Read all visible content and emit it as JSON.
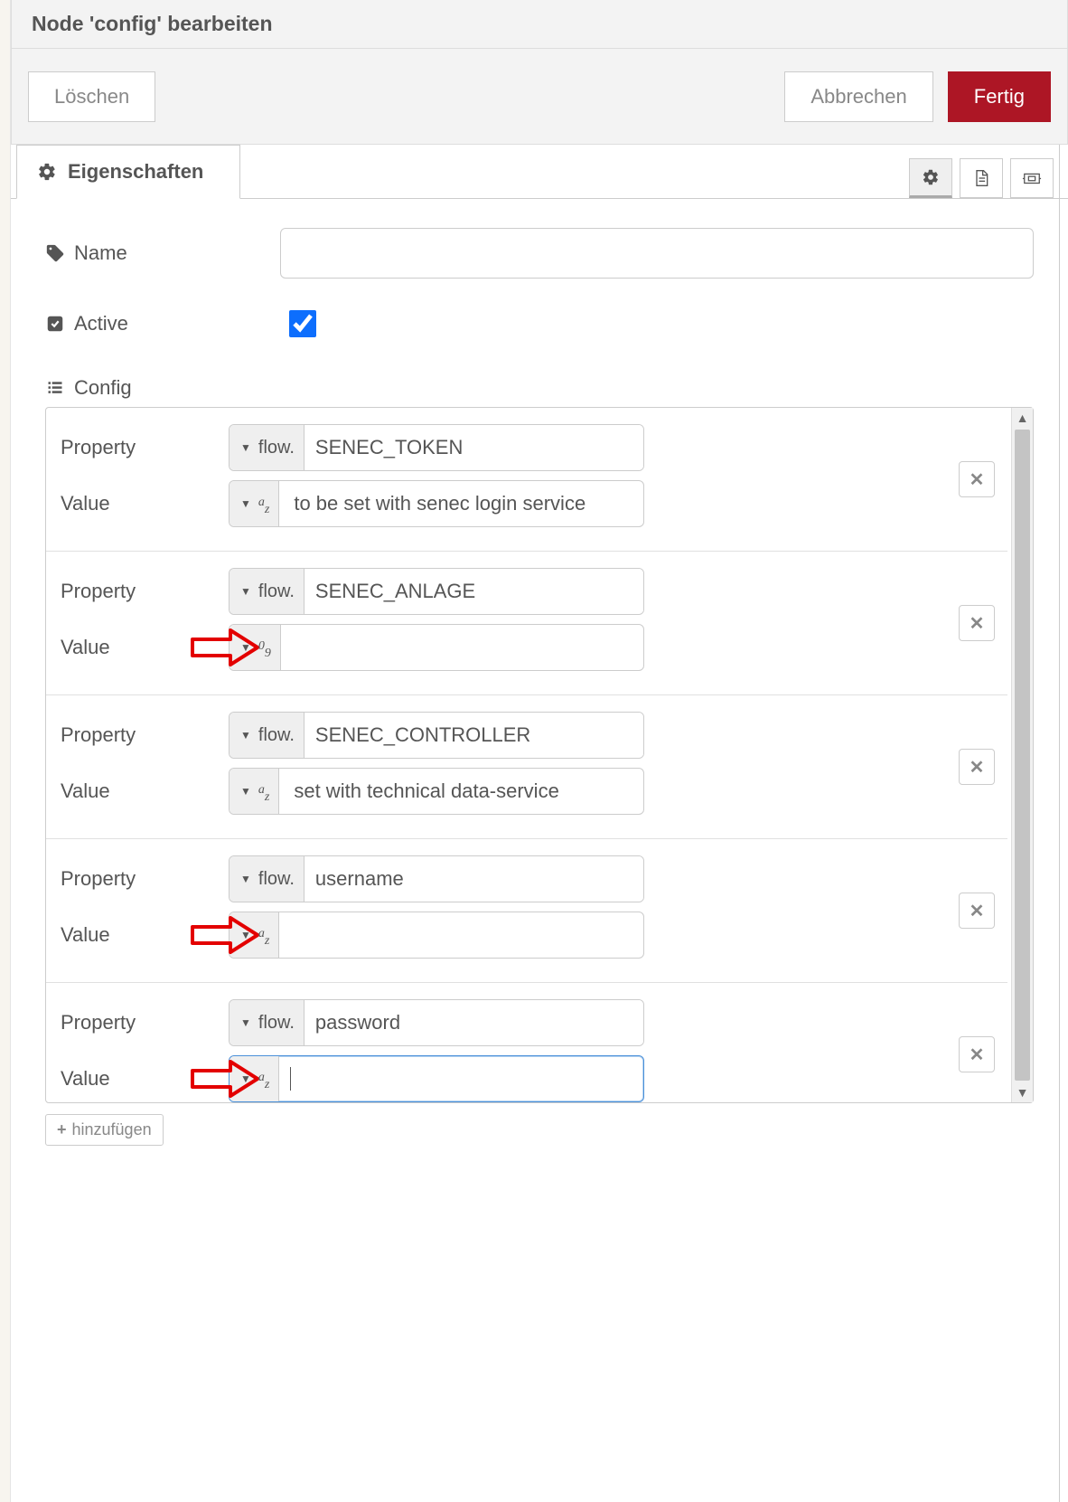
{
  "title": "Node 'config' bearbeiten",
  "buttons": {
    "delete": "Löschen",
    "cancel": "Abbrechen",
    "done": "Fertig"
  },
  "tab": {
    "properties": "Eigenschaften"
  },
  "labels": {
    "name": "Name",
    "active": "Active",
    "config": "Config",
    "property": "Property",
    "value": "Value",
    "flow_prefix": "flow.",
    "add": "hinzufügen"
  },
  "form": {
    "name_value": "",
    "active_checked": true
  },
  "items": [
    {
      "property": "SENEC_TOKEN",
      "value_type": "str",
      "value": "to be set with senec login service",
      "arrow": false,
      "focused": false
    },
    {
      "property": "SENEC_ANLAGE",
      "value_type": "num",
      "value": "",
      "arrow": true,
      "focused": false
    },
    {
      "property": "SENEC_CONTROLLER",
      "value_type": "str",
      "value": "set with technical data-service",
      "arrow": false,
      "focused": false
    },
    {
      "property": "username",
      "value_type": "str",
      "value": "",
      "arrow": true,
      "focused": false
    },
    {
      "property": "password",
      "value_type": "str",
      "value": "",
      "arrow": true,
      "focused": true
    }
  ],
  "type_icons": {
    "str": "az",
    "num": "09"
  }
}
